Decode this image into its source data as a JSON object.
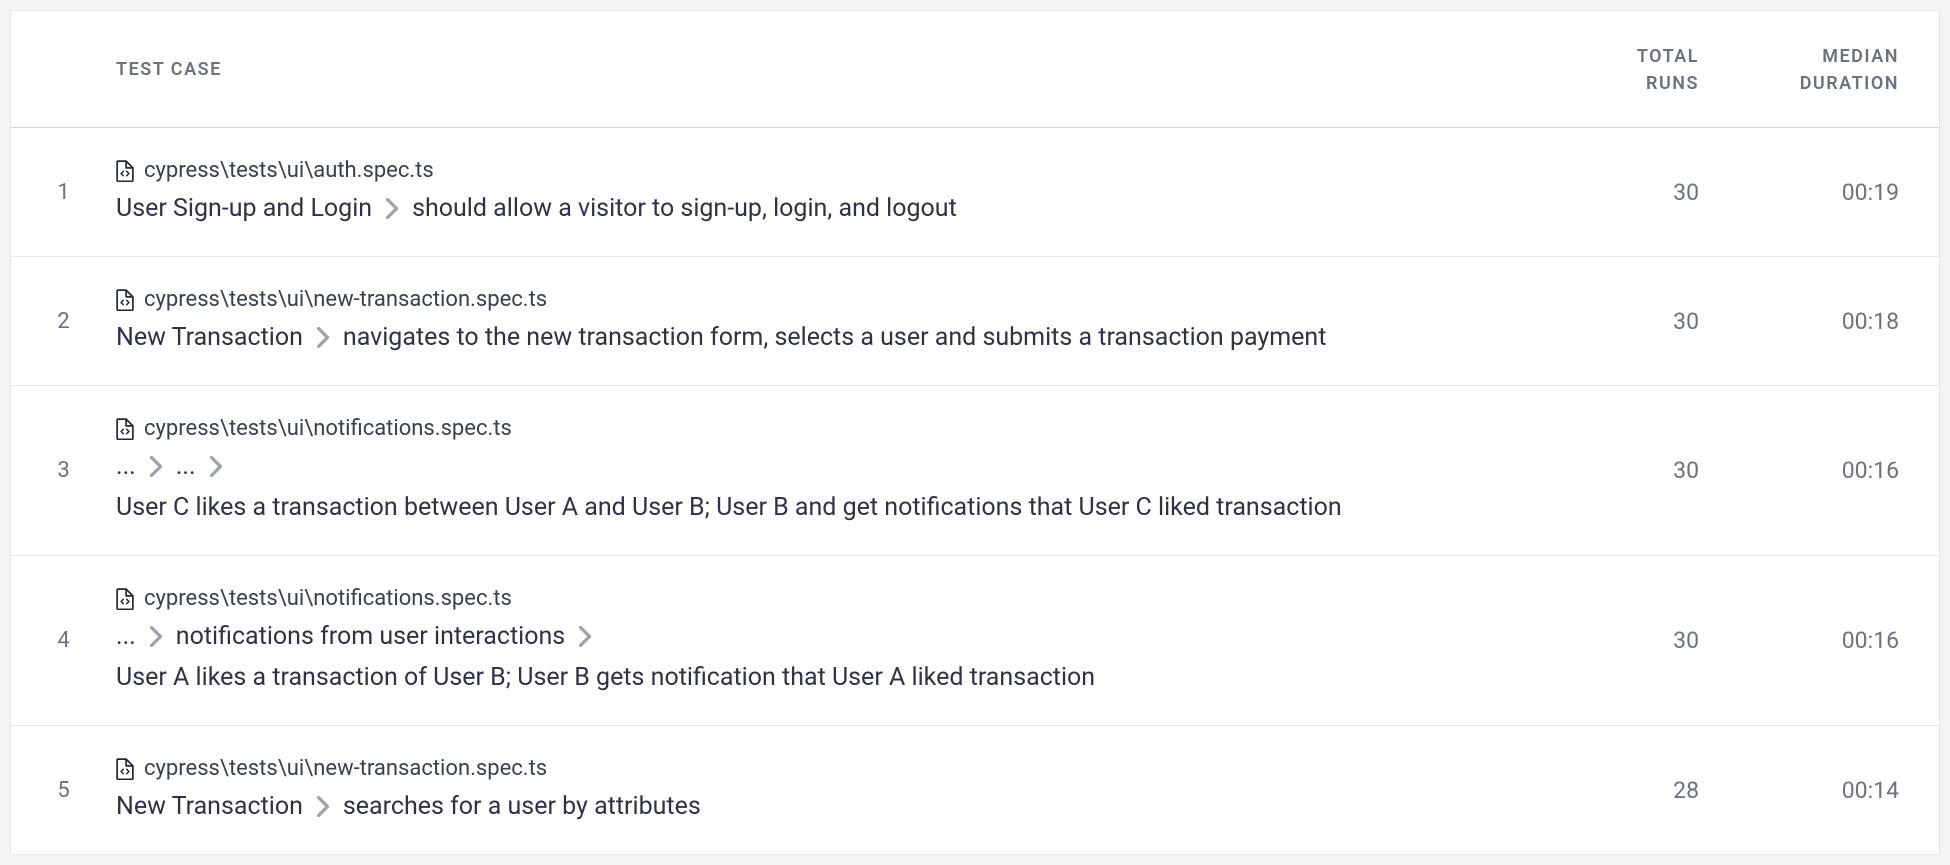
{
  "headers": {
    "testcase": "TEST CASE",
    "total_runs_line1": "TOTAL",
    "total_runs_line2": "RUNS",
    "median_duration_line1": "MEDIAN",
    "median_duration_line2": "DURATION"
  },
  "rows": [
    {
      "index": "1",
      "file": "cypress\\tests\\ui\\auth.spec.ts",
      "breadcrumb": [
        "User Sign-up and Login",
        "should allow a visitor to sign-up, login, and logout"
      ],
      "title": null,
      "runs": "30",
      "duration": "00:19"
    },
    {
      "index": "2",
      "file": "cypress\\tests\\ui\\new-transaction.spec.ts",
      "breadcrumb": [
        "New Transaction",
        "navigates to the new transaction form, selects a user and submits a transaction payment"
      ],
      "title": null,
      "runs": "30",
      "duration": "00:18"
    },
    {
      "index": "3",
      "file": "cypress\\tests\\ui\\notifications.spec.ts",
      "breadcrumb": [
        "...",
        "...",
        ""
      ],
      "title": "User C likes a transaction between User A and User B; User B and get notifications that User C liked transaction",
      "runs": "30",
      "duration": "00:16"
    },
    {
      "index": "4",
      "file": "cypress\\tests\\ui\\notifications.spec.ts",
      "breadcrumb": [
        "...",
        "notifications from user interactions",
        ""
      ],
      "title": "User A likes a transaction of User B; User B gets notification that User A liked transaction",
      "runs": "30",
      "duration": "00:16"
    },
    {
      "index": "5",
      "file": "cypress\\tests\\ui\\new-transaction.spec.ts",
      "breadcrumb": [
        "New Transaction",
        "searches for a user by attributes"
      ],
      "title": null,
      "runs": "28",
      "duration": "00:14"
    }
  ]
}
